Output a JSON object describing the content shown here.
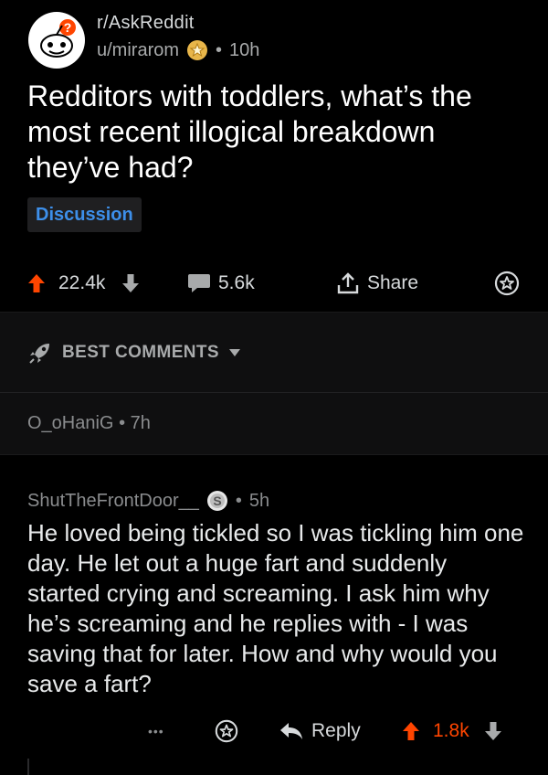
{
  "post": {
    "subreddit": "r/AskReddit",
    "username": "u/mirarom",
    "separator": "•",
    "age": "10h",
    "title": "Redditors with toddlers, what’s the most recent illogical breakdown they’ve had?",
    "flair": "Discussion"
  },
  "post_actions": {
    "upvotes": "22.4k",
    "comments": "5.6k",
    "share_label": "Share"
  },
  "sort": {
    "label": "BEST COMMENTS"
  },
  "collapsed_comment": {
    "username": "O_oHaniG",
    "separator": "•",
    "age": "7h"
  },
  "comment": {
    "username": "ShutTheFrontDoor__",
    "separator": "•",
    "age": "5h",
    "body": "He loved being tickled so I was tickling him one day. He let out a huge fart and suddenly started crying and screaming. I ask him why he’s screaming and he replies with - I was saving that for later. How and why would you save a fart?",
    "more_label": "•••",
    "reply_label": "Reply",
    "upvotes": "1.8k"
  },
  "colors": {
    "upvote": "#ff4500",
    "flair_text": "#3d8fea",
    "background": "#000000"
  }
}
